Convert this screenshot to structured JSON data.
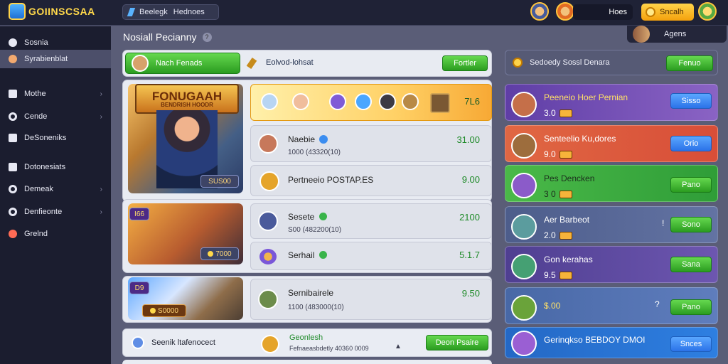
{
  "top": {
    "logo_text": "GOIINSCSAA",
    "nav_left": "Beelegk",
    "nav_right": "Hednoes",
    "user_label": "Hoes",
    "coin_label": "Sncalh",
    "corner_label": "Agens"
  },
  "sidebar": {
    "items": [
      {
        "label": "Sosnia",
        "icon": "globe-icon"
      },
      {
        "label": "Syrabienblat",
        "icon": "face-icon",
        "active": true
      },
      {
        "label": "Mothe",
        "icon": "mail-icon"
      },
      {
        "label": "Cende",
        "icon": "circle-icon"
      },
      {
        "label": "DeSoneniks",
        "icon": "grid-icon"
      },
      {
        "label": "Dotonesiats",
        "icon": "card-icon"
      },
      {
        "label": "Demeak",
        "icon": "clock-icon"
      },
      {
        "label": "Denfieonte",
        "icon": "gear-icon"
      },
      {
        "label": "Grelnd",
        "icon": "ball-icon"
      }
    ]
  },
  "page": {
    "title": "Nosiall Pecianny",
    "help": "?"
  },
  "main": {
    "top_tab_left": "Nach Fenads",
    "top_tab_right": "Eolvod-lohsat",
    "top_button": "Fortler",
    "hero_banner_title": "FONUGAAH",
    "hero_banner_sub": "BENDRISH HOODR",
    "hero_price": "SUS00",
    "art2_badge": "I66",
    "art2_price": "7000",
    "art3_badge": "D9",
    "art3_price": "S0000",
    "top_row_value": "7L6",
    "rows": [
      {
        "title": "Naebie",
        "sub": "1000 (43320(10)",
        "value": "31.00"
      },
      {
        "title": "Pertneeio POSTAP.ES",
        "sub": "",
        "value": "9.00"
      },
      {
        "title": "Sesete",
        "sub": "S00 (482200(10)",
        "value": "2100"
      },
      {
        "title": "Serhail",
        "sub": "",
        "value": "5.1.7"
      },
      {
        "title": "Sernibairele",
        "sub": "1100 (483000(10)",
        "value": "9.50"
      }
    ],
    "bottom_left": "Seenik ltafenocect",
    "bottom_center_title": "Geonlesh",
    "bottom_center_sub": "Fefnaeasbdetly 40360 0009",
    "bottom_button": "Deon Psaire"
  },
  "right": {
    "header_title": "Sedoedy Sossl Denara",
    "header_button": "Fenuo",
    "cards": [
      {
        "name": "Peeneio Hoer Pernian",
        "value": "3.0",
        "button": "Sisso",
        "color": "#6c45b3"
      },
      {
        "name": "Senteelio Ku,dores",
        "value": "9.0",
        "button": "Orio",
        "color": "#dc5b44"
      },
      {
        "name": "Pes Dencken",
        "value": "3 0",
        "button": "Pano",
        "color": "#40b94a"
      },
      {
        "name": "Aer Barbeot",
        "value": "2.0",
        "button": "Sono",
        "color": "#4f5f8d"
      },
      {
        "name": "Gon kerahas",
        "value": "9.5",
        "button": "Sana",
        "color": "#5f4fa0"
      },
      {
        "name": "$.00",
        "value": "",
        "button": "Pano",
        "color": "#4b67a4"
      },
      {
        "name": "Gerinqkso BEBDOY DMOI",
        "value": "",
        "button": "Snces",
        "color": "#2f6ac4"
      }
    ]
  },
  "colors": {
    "accent_green": "#35a62b",
    "accent_blue": "#2b72e8",
    "sidebar_bg": "#1b1d2f",
    "main_bg": "#5a5d77"
  }
}
